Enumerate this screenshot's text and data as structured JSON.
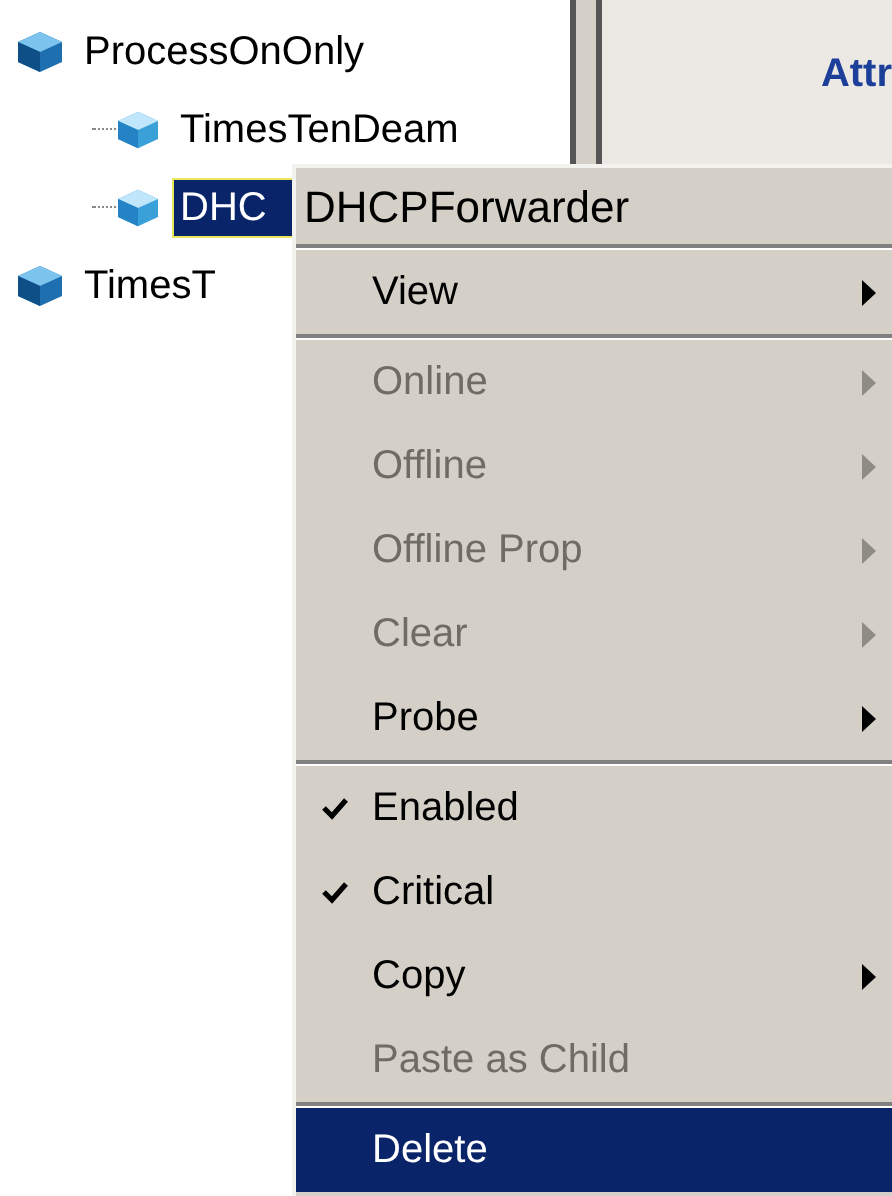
{
  "tree": [
    {
      "label": "ProcessOnOnly",
      "selected": false,
      "children": [
        {
          "label": "TimesTenDeam",
          "selected": false
        },
        {
          "label": "DHC",
          "selected": true
        }
      ]
    },
    {
      "label": "TimesT",
      "selected": false
    }
  ],
  "details": {
    "heading": "Attr"
  },
  "context_menu": {
    "title": "DHCPForwarder",
    "sections": [
      [
        {
          "label": "View",
          "disabled": false,
          "checked": false,
          "submenu": true,
          "selected": false
        }
      ],
      [
        {
          "label": "Online",
          "disabled": true,
          "checked": false,
          "submenu": true,
          "selected": false
        },
        {
          "label": "Offline",
          "disabled": true,
          "checked": false,
          "submenu": true,
          "selected": false
        },
        {
          "label": "Offline Prop",
          "disabled": true,
          "checked": false,
          "submenu": true,
          "selected": false
        },
        {
          "label": "Clear",
          "disabled": true,
          "checked": false,
          "submenu": true,
          "selected": false
        },
        {
          "label": "Probe",
          "disabled": false,
          "checked": false,
          "submenu": true,
          "selected": false
        }
      ],
      [
        {
          "label": "Enabled",
          "disabled": false,
          "checked": true,
          "submenu": false,
          "selected": false
        },
        {
          "label": "Critical",
          "disabled": false,
          "checked": true,
          "submenu": false,
          "selected": false
        },
        {
          "label": "Copy",
          "disabled": false,
          "checked": false,
          "submenu": true,
          "selected": false
        },
        {
          "label": "Paste as Child",
          "disabled": true,
          "checked": false,
          "submenu": false,
          "selected": false
        }
      ],
      [
        {
          "label": "Delete",
          "disabled": false,
          "checked": false,
          "submenu": false,
          "selected": true
        }
      ]
    ]
  }
}
